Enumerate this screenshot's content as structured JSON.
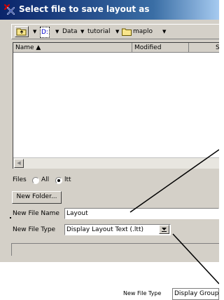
{
  "dialog": {
    "title": "Select file to save layout as"
  },
  "path_bar": {
    "crumbs": [
      {
        "label": "D:",
        "style": "drive"
      },
      {
        "label": "Data"
      },
      {
        "label": "tutorial"
      },
      {
        "label": "maplo",
        "icon": "folder-icon"
      }
    ]
  },
  "file_list": {
    "columns": [
      {
        "label": "Name ▲"
      },
      {
        "label": "Modified"
      },
      {
        "label": "Si"
      }
    ],
    "rows": []
  },
  "filter": {
    "label": "Files",
    "options": [
      {
        "label": "All",
        "selected": false
      },
      {
        "label": "ltt",
        "selected": true
      }
    ]
  },
  "new_folder_button": "New Folder...",
  "file_name": {
    "label": "New File Name",
    "value": "Layout"
  },
  "file_type": {
    "label": "New File Type",
    "value": "Display Layout Text (.ltt)"
  },
  "inset": {
    "label": "New File Type",
    "value": "Display Group"
  },
  "colors": {
    "title_start": "#0a246a",
    "title_end": "#a6caf0",
    "face": "#d4d0c8",
    "drive_link": "#0000cc"
  }
}
